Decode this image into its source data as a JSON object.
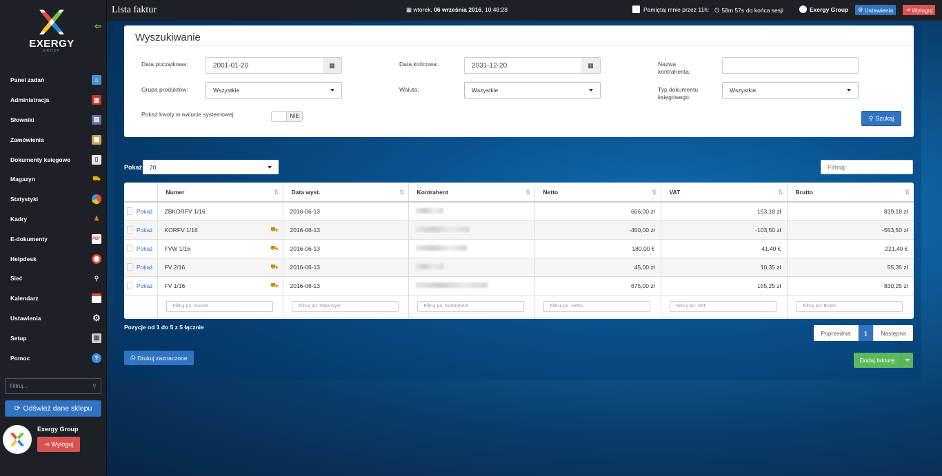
{
  "topbar": {
    "page_title": "Lista faktur",
    "datetime_day": "wtorek, ",
    "datetime_date": "06 września 2016",
    "datetime_time": ", 10:48:28",
    "remember_label": "Pamiętaj mnie przez 11h:",
    "session_time": "58m 57s",
    "session_suffix": "do końca sesji",
    "company": "Exergy Group",
    "settings_label": "Ustawienia",
    "logout_label": "Wyloguj"
  },
  "sidebar": {
    "brand": "EXERGY",
    "brand_sub": "GROUP",
    "items": [
      {
        "label": "Panel zadań",
        "icon": "home-icon"
      },
      {
        "label": "Administracja",
        "icon": "books-icon"
      },
      {
        "label": "Słowniki",
        "icon": "dictionary-icon"
      },
      {
        "label": "Zamówienia",
        "icon": "package-icon"
      },
      {
        "label": "Dokumenty księgowe",
        "icon": "document-icon"
      },
      {
        "label": "Magazyn",
        "icon": "forklift-icon"
      },
      {
        "label": "Statystyki",
        "icon": "pie-chart-icon"
      },
      {
        "label": "Kadry",
        "icon": "person-icon"
      },
      {
        "label": "E-dokumenty",
        "icon": "pdf-icon"
      },
      {
        "label": "Helpdesk",
        "icon": "lifebuoy-icon"
      },
      {
        "label": "Sieć",
        "icon": "network-icon"
      },
      {
        "label": "Kalendarz",
        "icon": "calendar-icon"
      },
      {
        "label": "Ustawienia",
        "icon": "gear-icon"
      },
      {
        "label": "Setup",
        "icon": "setup-icon"
      },
      {
        "label": "Pomoc",
        "icon": "help-icon"
      }
    ],
    "filter_placeholder": "Filtruj...",
    "refresh_label": "Odśwież dane sklepu",
    "user_name": "Exergy Group",
    "logout_label": "Wyloguj"
  },
  "search": {
    "title": "Wyszukiwanie",
    "date_from_label": "Data początkowa:",
    "date_from_value": "2001-01-20",
    "date_to_label": "Data końcowa:",
    "date_to_value": "2031-12-20",
    "contractor_label_1": "Nazwa",
    "contractor_label_2": "kontrahenta:",
    "contractor_value": "",
    "product_group_label": "Grupa produktów:",
    "product_group_value": "Wszystkie",
    "currency_label": "Waluta:",
    "currency_value": "Wszystkie",
    "doc_type_label_1": "Typ dokumentu",
    "doc_type_label_2": "księgowego:",
    "doc_type_value": "Wszystkie",
    "system_currency_label": "Pokaż kwoty w walucie systemowej:",
    "system_currency_value": "NIE",
    "search_button": "Szukaj"
  },
  "list": {
    "show_label": "Pokaż",
    "show_value": "20",
    "filter_label": "Filtruj:",
    "columns": [
      "Numer",
      "Data wyst.",
      "Kontrahent",
      "Netto",
      "VAT",
      "Brutto"
    ],
    "rows": [
      {
        "link": "Pokaż",
        "numer": "ZBKORFV 1/16",
        "correction": false,
        "data": "2016-06-13",
        "netto": "666,00 zł",
        "vat": "153,18 zł",
        "brutto": "819,18 zł"
      },
      {
        "link": "Pokaż",
        "numer": "KORFV 1/16",
        "correction": true,
        "data": "2016-06-13",
        "netto": "-450,00 zł",
        "vat": "-103,50 zł",
        "brutto": "-553,50 zł"
      },
      {
        "link": "Pokaż",
        "numer": "FVW 1/16",
        "correction": true,
        "data": "2016-06-13",
        "netto": "180,00 €",
        "vat": "41,40 €",
        "brutto": "221,40 €"
      },
      {
        "link": "Pokaż",
        "numer": "FV 2/16",
        "correction": true,
        "data": "2016-06-13",
        "netto": "45,00 zł",
        "vat": "10,35 zł",
        "brutto": "55,35 zł"
      },
      {
        "link": "Pokaż",
        "numer": "FV 1/16",
        "correction": true,
        "data": "2016-06-13",
        "netto": "675,00 zł",
        "vat": "155,25 zł",
        "brutto": "830,25 zł"
      }
    ],
    "column_filters": [
      "Filtruj po: Numer",
      "Filtruj po: Data wyst.",
      "Filtruj po: Kontrahent",
      "Filtruj po: Netto",
      "Filtruj po: VAT",
      "Filtruj po: Brutto"
    ],
    "info": "Pozycje od 1 do 5 z 5 łącznie",
    "prev_label": "Poprzednia",
    "current_page": "1",
    "next_label": "Następna",
    "print_label": "Drukuj zaznaczone",
    "add_label": "Dodaj fakturę"
  },
  "colors": {
    "sidebar_bg": "#1d2127",
    "primary": "#3174c1",
    "danger": "#d9534f",
    "success": "#5cb85c"
  }
}
